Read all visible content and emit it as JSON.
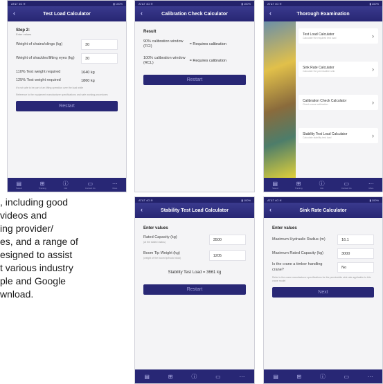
{
  "tabs": [
    {
      "label": "Saved",
      "icon": "saved-icon"
    },
    {
      "label": "Training",
      "icon": "training-icon"
    },
    {
      "label": "Info",
      "icon": "info-icon"
    },
    {
      "label": "Contact Us",
      "icon": "contact-icon"
    },
    {
      "label": "More",
      "icon": "more-icon"
    }
  ],
  "status": {
    "left": "AT&T 4G ≋",
    "time": "",
    "right": "▮ 100%"
  },
  "screen1": {
    "title": "Test Load Calculator",
    "step": "Step 2:",
    "step_sub": "Enter values",
    "fields": [
      {
        "label": "Weight of chains/slings (kg)",
        "value": "30"
      },
      {
        "label": "Weight of shackles/lifting eyes (kg)",
        "value": "30"
      }
    ],
    "results": [
      {
        "label": "110% Test weight required",
        "value": "1640 kg"
      },
      {
        "label": "125% Test weight required",
        "value": "1860 kg"
      }
    ],
    "note1": "It's not safe to be part of an lifting operation over the load while",
    "note2": "Reference to the equipment manufacturer specifications and safe working procedures",
    "restart": "Restart"
  },
  "screen2": {
    "title": "Calibration Check Calculator",
    "result_label": "Result",
    "rows": [
      {
        "label": "90% calibration window (FCI)",
        "value": "= Requires calibration"
      },
      {
        "label": "100% calibration window (RCL)",
        "value": "= Requires calibration"
      }
    ],
    "restart": "Restart"
  },
  "screen3": {
    "title": "Thorough Examination",
    "items": [
      {
        "title": "Test Load Calculator",
        "sub": "Calculate the required test load"
      },
      {
        "title": "Sink Rate Calculator",
        "sub": "Calculate the permissible sink"
      },
      {
        "title": "Calibration Check Calculator",
        "sub": "Check crane calibration"
      },
      {
        "title": "Stability Test Load Calculator",
        "sub": "Calculate stability test load"
      }
    ]
  },
  "screen4": {
    "title": "Stability Test Load Calculator",
    "enter": "Enter values",
    "fields": [
      {
        "label": "Rated Capacity (kg)",
        "sub": "(at the stated radius)",
        "value": "3500"
      },
      {
        "label": "Boom Tip Weight (kg)",
        "sub": "(weight of the boom tip/hook block)",
        "value": "1205"
      }
    ],
    "result": "Stability Test Load = 3661 kg",
    "restart": "Restart"
  },
  "screen5": {
    "title": "Sink Rate Calculator",
    "enter": "Enter values",
    "fields": [
      {
        "label": "Maximum Hydraulic Radius (m)",
        "value": "16.1"
      },
      {
        "label": "Maximum Rated Capacity (kg)",
        "value": "3000"
      },
      {
        "label": "Is the crane a timber handling crane?",
        "value": "No"
      }
    ],
    "note": "Refer to the crane manufacturer specifications for the permissible sink rate applicable to this crane model",
    "next": "Next"
  },
  "article": {
    "lines": [
      ", including good",
      " videos and",
      "ing provider/",
      "es, and a range of",
      "esigned to assist",
      "t various industry",
      "ple and Google",
      "wnload."
    ]
  }
}
